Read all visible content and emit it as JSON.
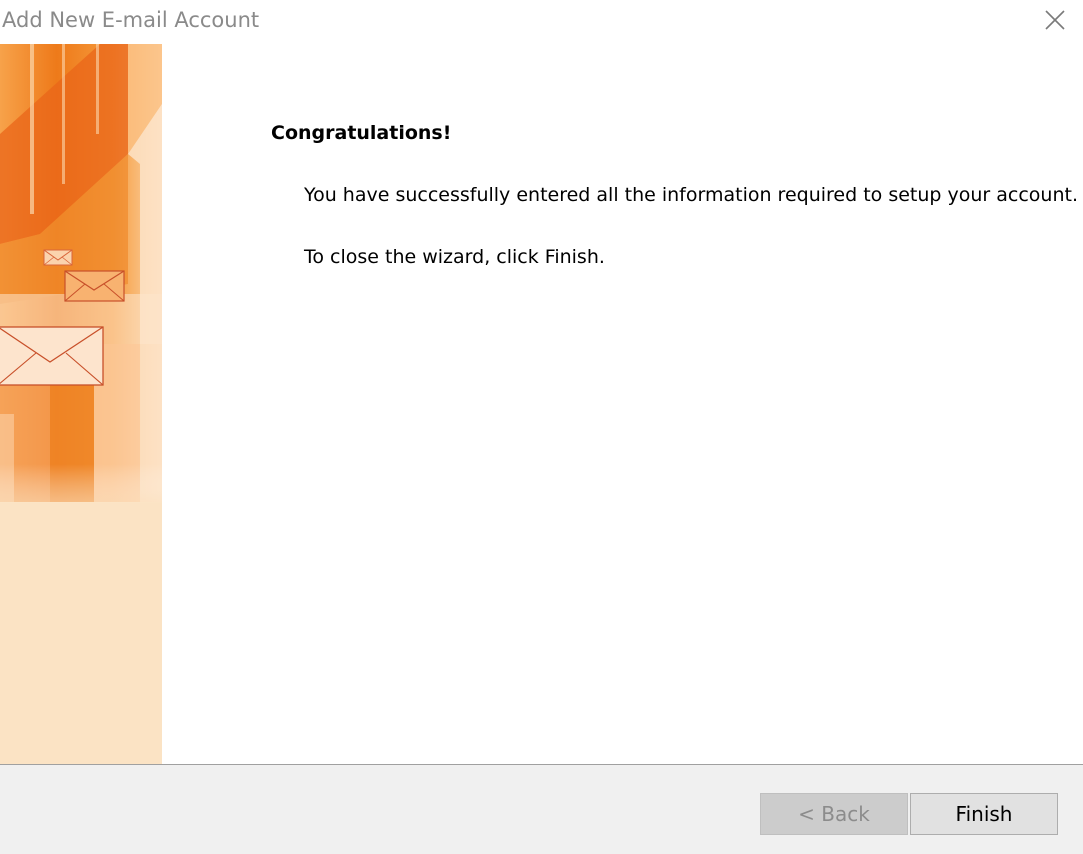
{
  "window": {
    "title": "Add New E-mail Account",
    "close_icon": "close-icon"
  },
  "banner": {
    "icons": [
      "envelope-icon",
      "envelope-icon",
      "envelope-icon"
    ]
  },
  "main": {
    "heading": "Congratulations!",
    "message": "You have successfully entered all the information required to setup your account.",
    "instruction": "To close the wizard, click Finish."
  },
  "footer": {
    "back_label": "< Back",
    "finish_label": "Finish"
  },
  "colors": {
    "accent_orange": "#f08a1e",
    "banner_base": "#fbe3c4",
    "footer_bg": "#f0f0f0"
  }
}
